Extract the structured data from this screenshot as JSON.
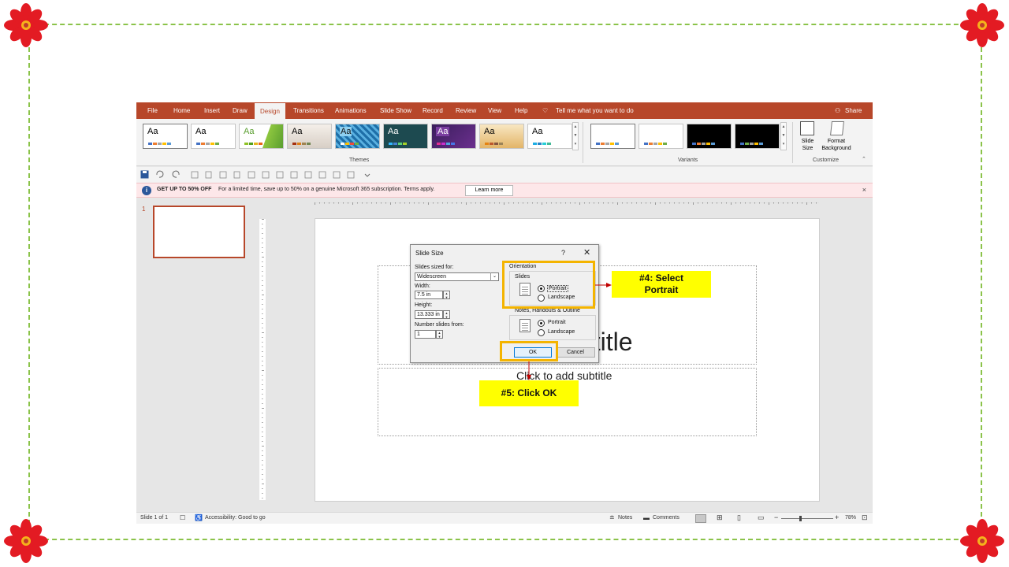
{
  "tabs": [
    "File",
    "Home",
    "Insert",
    "Draw",
    "Design",
    "Transitions",
    "Animations",
    "Slide Show",
    "Record",
    "Review",
    "View",
    "Help"
  ],
  "tell_me": "Tell me what you want to do",
  "share": "Share",
  "theme_label": "Aa",
  "groups": {
    "themes": "Themes",
    "variants": "Variants",
    "customize": "Customize"
  },
  "customize": {
    "slide_size_line1": "Slide",
    "slide_size_line2": "Size",
    "format_line1": "Format",
    "format_line2": "Background"
  },
  "notice": {
    "headline": "GET UP TO 50% OFF",
    "text": "For a limited time, save up to 50% on a genuine Microsoft 365 subscription. Terms apply.",
    "button": "Learn more",
    "close": "×"
  },
  "thumbnail_number": "1",
  "slide": {
    "title_partial": "d title",
    "subtitle": "Click to add subtitle"
  },
  "dialog": {
    "title": "Slide Size",
    "help": "?",
    "close": "✕",
    "sized_for_label": "Slides sized for:",
    "sized_for_value": "Widescreen",
    "width_label": "Width:",
    "width_value": "7.5 in",
    "height_label": "Height:",
    "height_value": "13.333 in",
    "number_label": "Number slides from:",
    "number_value": "1",
    "orientation_label": "Orientation",
    "slides_label": "Slides",
    "portrait": "Portrait",
    "landscape": "Landscape",
    "notes_label": "Notes, Handouts & Outline",
    "ok": "OK",
    "cancel": "Cancel"
  },
  "callouts": {
    "step4_line1": "#4: Select",
    "step4_line2": "Portrait",
    "step5": "#5: Click OK"
  },
  "status": {
    "slide_count": "Slide 1 of 1",
    "accessibility": "Accessibility: Good to go",
    "notes": "Notes",
    "comments": "Comments",
    "zoom": "78%"
  },
  "colors": {
    "accent": "#b7472a",
    "highlight": "#f4b400",
    "callout_bg": "#ffff00",
    "frame": "#8bc34a",
    "flower": "#e31b23"
  }
}
